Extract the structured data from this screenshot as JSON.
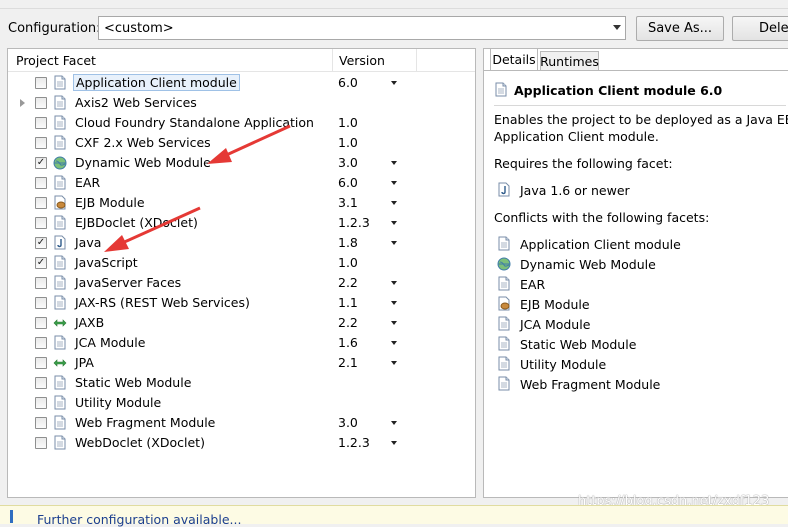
{
  "config": {
    "label": "Configuration:",
    "value": "<custom>",
    "save_as": "Save As...",
    "delete": "Delete"
  },
  "facets": {
    "col_name": "Project Facet",
    "col_version": "Version",
    "rows": [
      {
        "name": "Application Client module",
        "version": "6.0",
        "checked": false,
        "dropdown": true,
        "icon": "file-icon",
        "selected": true,
        "expander": false
      },
      {
        "name": "Axis2 Web Services",
        "version": "",
        "checked": false,
        "dropdown": false,
        "icon": "file-icon",
        "selected": false,
        "expander": true
      },
      {
        "name": "Cloud Foundry Standalone Application",
        "version": "1.0",
        "checked": false,
        "dropdown": false,
        "icon": "file-icon",
        "selected": false,
        "expander": false
      },
      {
        "name": "CXF 2.x Web Services",
        "version": "1.0",
        "checked": false,
        "dropdown": false,
        "icon": "file-icon",
        "selected": false,
        "expander": false
      },
      {
        "name": "Dynamic Web Module",
        "version": "3.0",
        "checked": true,
        "dropdown": true,
        "icon": "globe-icon",
        "selected": false,
        "expander": false
      },
      {
        "name": "EAR",
        "version": "6.0",
        "checked": false,
        "dropdown": true,
        "icon": "file-icon",
        "selected": false,
        "expander": false
      },
      {
        "name": "EJB Module",
        "version": "3.1",
        "checked": false,
        "dropdown": true,
        "icon": "bean-icon",
        "selected": false,
        "expander": false
      },
      {
        "name": "EJBDoclet (XDoclet)",
        "version": "1.2.3",
        "checked": false,
        "dropdown": true,
        "icon": "file-icon",
        "selected": false,
        "expander": false
      },
      {
        "name": "Java",
        "version": "1.8",
        "checked": true,
        "dropdown": true,
        "icon": "java-icon",
        "selected": false,
        "expander": false
      },
      {
        "name": "JavaScript",
        "version": "1.0",
        "checked": true,
        "dropdown": false,
        "icon": "file-icon",
        "selected": false,
        "expander": false
      },
      {
        "name": "JavaServer Faces",
        "version": "2.2",
        "checked": false,
        "dropdown": true,
        "icon": "file-icon",
        "selected": false,
        "expander": false
      },
      {
        "name": "JAX-RS (REST Web Services)",
        "version": "1.1",
        "checked": false,
        "dropdown": true,
        "icon": "file-icon",
        "selected": false,
        "expander": false
      },
      {
        "name": "JAXB",
        "version": "2.2",
        "checked": false,
        "dropdown": true,
        "icon": "arrows-icon",
        "selected": false,
        "expander": false
      },
      {
        "name": "JCA Module",
        "version": "1.6",
        "checked": false,
        "dropdown": true,
        "icon": "file-icon",
        "selected": false,
        "expander": false
      },
      {
        "name": "JPA",
        "version": "2.1",
        "checked": false,
        "dropdown": true,
        "icon": "arrows-icon",
        "selected": false,
        "expander": false
      },
      {
        "name": "Static Web Module",
        "version": "",
        "checked": false,
        "dropdown": false,
        "icon": "file-icon",
        "selected": false,
        "expander": false
      },
      {
        "name": "Utility Module",
        "version": "",
        "checked": false,
        "dropdown": false,
        "icon": "file-icon",
        "selected": false,
        "expander": false
      },
      {
        "name": "Web Fragment Module",
        "version": "3.0",
        "checked": false,
        "dropdown": true,
        "icon": "file-icon",
        "selected": false,
        "expander": false
      },
      {
        "name": "WebDoclet (XDoclet)",
        "version": "1.2.3",
        "checked": false,
        "dropdown": true,
        "icon": "file-icon",
        "selected": false,
        "expander": false
      }
    ]
  },
  "details": {
    "tabs": [
      "Details",
      "Runtimes"
    ],
    "title": "Application Client module 6.0",
    "desc_line1": "Enables the project to be deployed as a Java EE",
    "desc_line2": "Application Client module.",
    "requires_label": "Requires the following facet:",
    "requires": [
      {
        "name": "Java 1.6 or newer",
        "icon": "java-icon"
      }
    ],
    "conflicts_label": "Conflicts with the following facets:",
    "conflicts": [
      {
        "name": "Application Client module",
        "icon": "file-icon"
      },
      {
        "name": "Dynamic Web Module",
        "icon": "globe-icon"
      },
      {
        "name": "EAR",
        "icon": "file-icon"
      },
      {
        "name": "EJB Module",
        "icon": "bean-icon"
      },
      {
        "name": "JCA Module",
        "icon": "file-icon"
      },
      {
        "name": "Static Web Module",
        "icon": "file-icon"
      },
      {
        "name": "Utility Module",
        "icon": "file-icon"
      },
      {
        "name": "Web Fragment Module",
        "icon": "file-icon"
      }
    ]
  },
  "infobar": {
    "text": "Further configuration available..."
  },
  "watermark": "https://blog.csdn.net/zxdf123",
  "colors": {
    "arrow": "#e53935",
    "link": "#1c3f8f",
    "selection": "#e8f1fb"
  }
}
